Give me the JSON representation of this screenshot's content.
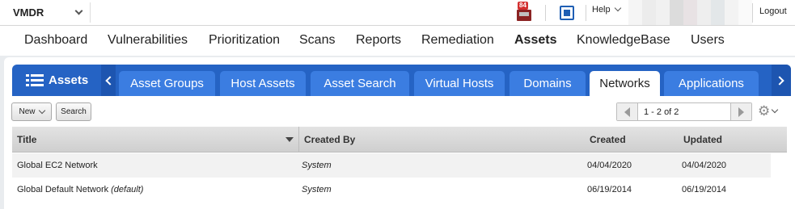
{
  "topbar": {
    "app_name": "VMDR",
    "inbox_badge": "84",
    "help_label": "Help",
    "logout_label": "Logout"
  },
  "nav": {
    "items": [
      "Dashboard",
      "Vulnerabilities",
      "Prioritization",
      "Scans",
      "Reports",
      "Remediation",
      "Assets",
      "KnowledgeBase",
      "Users"
    ],
    "active": "Assets"
  },
  "section": {
    "title": "Assets"
  },
  "tabs": {
    "items": [
      "Asset Groups",
      "Host Assets",
      "Asset Search",
      "Virtual Hosts",
      "Domains",
      "Networks",
      "Applications"
    ],
    "active": "Networks"
  },
  "toolbar": {
    "new_label": "New",
    "search_label": "Search",
    "pager_text": "1 - 2 of 2"
  },
  "table": {
    "columns": [
      "Title",
      "Created By",
      "Created",
      "Updated"
    ],
    "rows": [
      {
        "title": "Global EC2 Network",
        "title_note": "",
        "created_by": "System",
        "created": "04/04/2020",
        "updated": "04/04/2020"
      },
      {
        "title": "Global Default Network",
        "title_note": "(default)",
        "created_by": "System",
        "created": "06/19/2014",
        "updated": "06/19/2014"
      }
    ]
  },
  "colors": {
    "accent_blue": "#2563c4",
    "tab_blue": "#3b7de1",
    "inbox_red": "#8b2323"
  },
  "icons": [
    "chevron-down-icon",
    "inbox-icon",
    "calendar-icon",
    "menu-icon",
    "arrow-left-icon",
    "arrow-right-icon",
    "gear-icon",
    "sort-down-icon"
  ]
}
